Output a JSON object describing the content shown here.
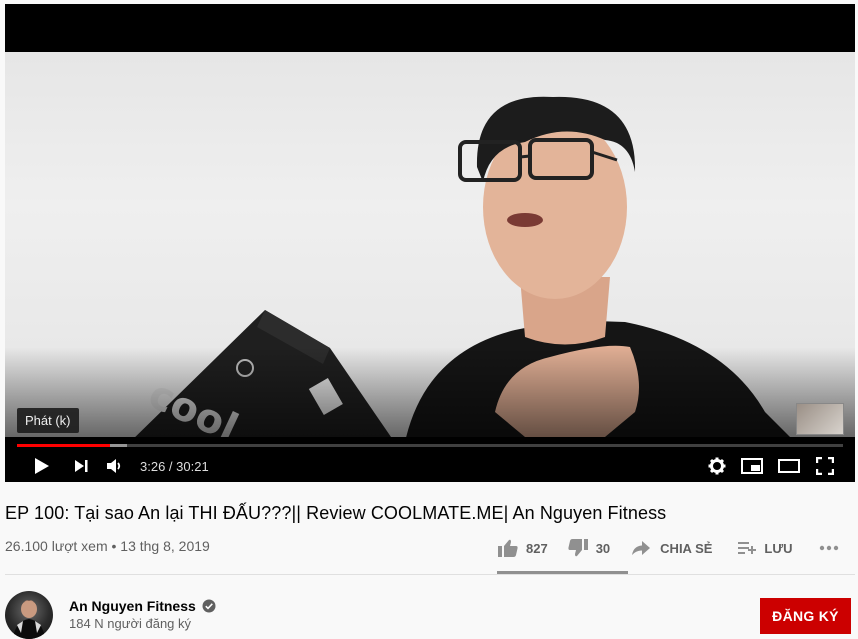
{
  "player": {
    "tooltip": "Phát (k)",
    "time_current": "3:26",
    "time_separator": " / ",
    "time_total": "30:21",
    "progress_played_fraction": 0.113,
    "progress_loaded_fraction": 0.133
  },
  "video": {
    "title": "EP 100: Tại sao An lại THI ĐẤU???|| Review COOLMATE.ME| An Nguyen Fitness",
    "views": "26.100 lượt xem",
    "dot": " • ",
    "date": "13 thg 8, 2019"
  },
  "actions": {
    "likes": "827",
    "dislikes": "30",
    "share_label": "CHIA SẺ",
    "save_label": "LƯU",
    "like_fraction": 0.965
  },
  "channel": {
    "name": "An Nguyen Fitness",
    "subscribers": "184 N người đăng ký",
    "subscribe_label": "ĐĂNG KÝ"
  },
  "colors": {
    "accent_red": "#cc0000",
    "progress_red": "#ff0000"
  },
  "icons": [
    "play-icon",
    "next-icon",
    "volume-icon",
    "settings-icon",
    "miniplayer-icon",
    "theater-icon",
    "fullscreen-icon",
    "thumb-up-icon",
    "thumb-down-icon",
    "share-icon",
    "save-playlist-icon",
    "more-icon",
    "verified-icon"
  ]
}
